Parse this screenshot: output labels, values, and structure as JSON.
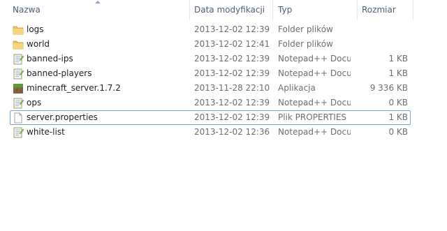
{
  "columns": {
    "name": "Nazwa",
    "date": "Data modyfikacji",
    "type": "Typ",
    "size": "Rozmiar"
  },
  "files": [
    {
      "name": "logs",
      "date": "2013-12-02 12:39",
      "type": "Folder plików",
      "size": "",
      "icon": "folder-icon"
    },
    {
      "name": "world",
      "date": "2013-12-02 12:41",
      "type": "Folder plików",
      "size": "",
      "icon": "folder-icon"
    },
    {
      "name": "banned-ips",
      "date": "2013-12-02 12:39",
      "type": "Notepad++ Docu...",
      "size": "1 KB",
      "icon": "notepad-document-icon"
    },
    {
      "name": "banned-players",
      "date": "2013-12-02 12:39",
      "type": "Notepad++ Docu...",
      "size": "1 KB",
      "icon": "notepad-document-icon"
    },
    {
      "name": "minecraft_server.1.7.2",
      "date": "2013-11-28 22:10",
      "type": "Aplikacja",
      "size": "9 336 KB",
      "icon": "minecraft-grass-block-icon"
    },
    {
      "name": "ops",
      "date": "2013-12-02 12:39",
      "type": "Notepad++ Docu...",
      "size": "0 KB",
      "icon": "notepad-document-icon"
    },
    {
      "name": "server.properties",
      "date": "2013-12-02 12:39",
      "type": "Plik PROPERTIES",
      "size": "1 KB",
      "icon": "blank-file-icon"
    },
    {
      "name": "white-list",
      "date": "2013-12-02 12:36",
      "type": "Notepad++ Docu...",
      "size": "0 KB",
      "icon": "notepad-document-icon"
    }
  ],
  "colors": {
    "header_text": "#4c607a",
    "detail_text": "#6d6d6d",
    "focus_border": "#7da2ce",
    "folder": "#e8c25a"
  }
}
